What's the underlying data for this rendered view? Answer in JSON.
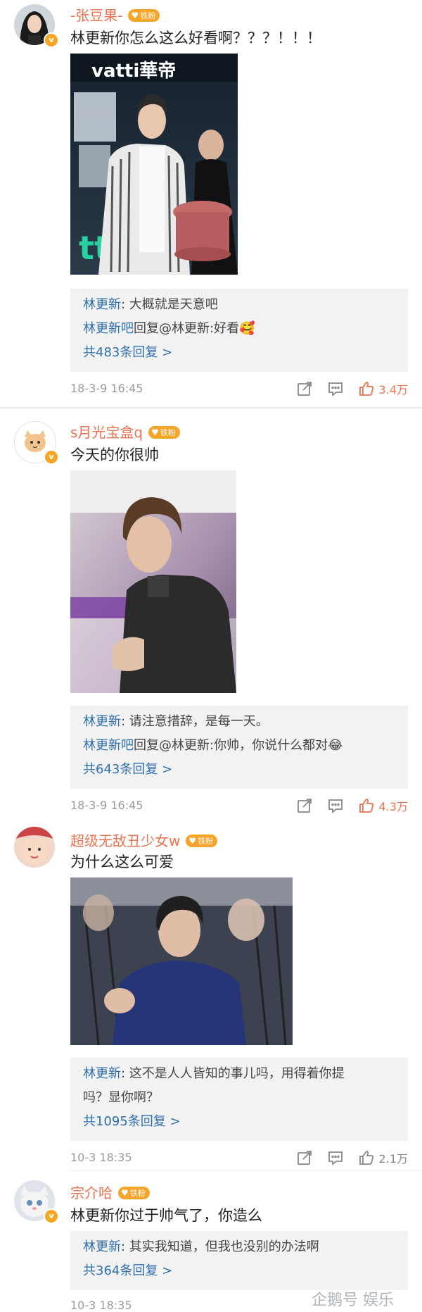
{
  "badge_label": "铁粉",
  "comments": [
    {
      "username": "-张豆果-",
      "text": "林更新你怎么这么好看啊？？？！！！",
      "replies": [
        {
          "name": "林更新",
          "text": ": 大概就是天意吧"
        },
        {
          "name": "林更新吧",
          "text": "回复@林更新:好看🥰"
        }
      ],
      "more": "共483条回复 >",
      "time": "18-3-9 16:45",
      "likes": "3.4万"
    },
    {
      "username": "s月光宝盒q",
      "text": "今天的你很帅",
      "replies": [
        {
          "name": "林更新",
          "text": ": 请注意措辞，是每一天。"
        },
        {
          "name": "林更新吧",
          "text": "回复@林更新:你帅，你说什么都对😂"
        }
      ],
      "more": "共643条回复 >",
      "time": "18-3-9 16:45",
      "likes": "4.3万"
    },
    {
      "username": "超级无敌丑少女w",
      "text": "为什么这么可爱",
      "replies": [
        {
          "name": "林更新",
          "text": ": 这不是人人皆知的事儿吗，用得着你提"
        },
        {
          "name": "",
          "text": "吗？显你啊？"
        }
      ],
      "more": "共1095条回复 >",
      "time": "10-3 18:35",
      "likes": "2.1万"
    },
    {
      "username": "宗介哈",
      "text": "林更新你过于帅气了，你造么",
      "replies": [
        {
          "name": "林更新",
          "text": ": 其实我知道，但我也没别的办法啊"
        }
      ],
      "more": "共364条回复 >",
      "time": "10-3 18:35"
    }
  ],
  "photo1_sign": "vatti華帝",
  "watermark": "企鹅号 娱乐",
  "icons": {
    "share": "share-icon",
    "comment": "comment-icon",
    "like": "thumbs-up-icon",
    "verified": "verified-badge-icon"
  },
  "colors": {
    "username": "#eb7350",
    "link": "#2f6fb0",
    "badge": "#f7a428",
    "liked": "#eb7350"
  }
}
